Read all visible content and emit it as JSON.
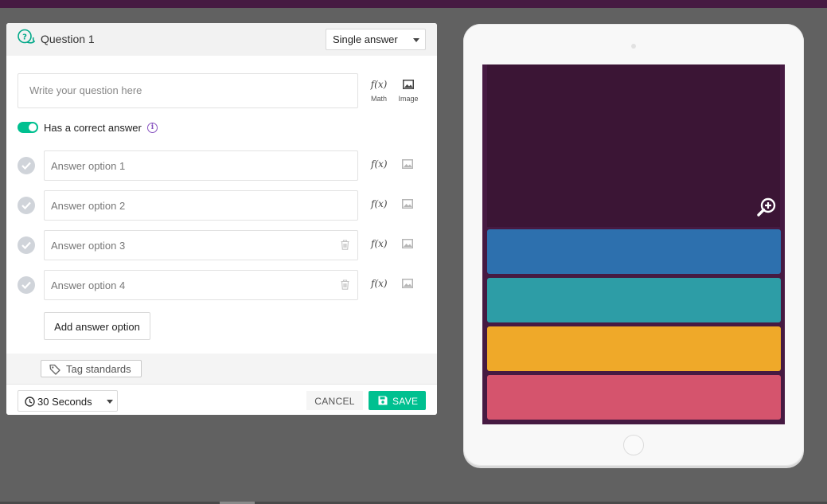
{
  "editor": {
    "title": "Question 1",
    "type_select": "Single answer",
    "question_placeholder": "Write your question here",
    "tools": {
      "math": "Math",
      "image": "Image"
    },
    "fx_glyph": "f(x)",
    "correct_toggle": {
      "label": "Has a correct answer",
      "on": true,
      "info_glyph": "i"
    },
    "answers": [
      {
        "placeholder": "Answer option 1",
        "deletable": false
      },
      {
        "placeholder": "Answer option 2",
        "deletable": false
      },
      {
        "placeholder": "Answer option 3",
        "deletable": true
      },
      {
        "placeholder": "Answer option 4",
        "deletable": true
      }
    ],
    "add_answer_label": "Add answer option",
    "tag_label": "Tag standards",
    "time_select": "30 Seconds",
    "cancel_label": "CANCEL",
    "save_label": "SAVE"
  },
  "preview": {
    "option_colors": [
      "#2d70ae",
      "#2d9da6",
      "#efa929",
      "#d5546d"
    ],
    "accent": "#00c090",
    "brand": "#461a42"
  }
}
